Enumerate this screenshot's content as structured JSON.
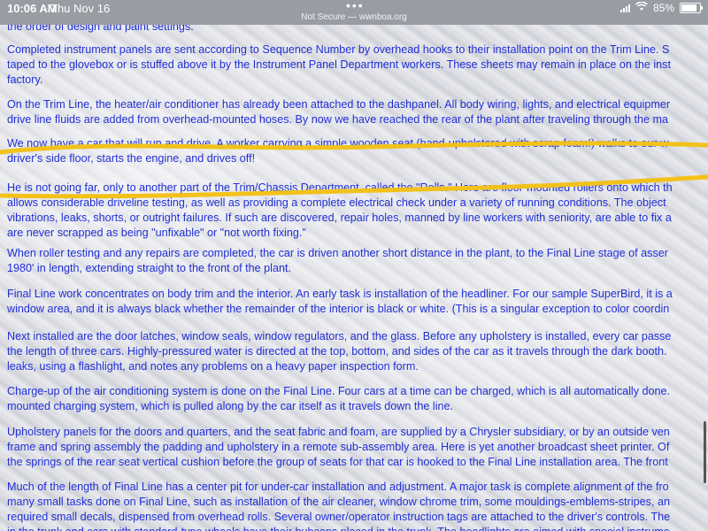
{
  "status_bar": {
    "time": "10:06 AM",
    "date": "Thu Nov 16",
    "url": "Not Secure — wwnboa.org",
    "battery": "85%",
    "battery_level": 0.85
  },
  "paragraphs": [
    {
      "lines": [
        "the order of design and paint settings."
      ]
    },
    {
      "lines": [
        "Completed instrument panels are sent according to Sequence Number by overhead hooks to their installation point on the Trim Line. S",
        "taped to the glovebox or is stuffed above it by the Instrument Panel Department workers. These sheets may remain in place on the inst",
        "factory."
      ]
    },
    {
      "lines": [
        "On the Trim Line, the heater/air conditioner has already been attached to the dashpanel. All body wiring, lights, and electrical equipmer",
        "drive line fluids are added from overhead-mounted hoses. By now we have reached the rear of the plant after traveling through the ma"
      ]
    },
    {
      "lines": [
        "We now have a car that will run and drive. A worker carrying a simple wooden seat (hand-upholstered with scrap foam!) walks to our w",
        "driver's side floor, starts the engine, and drives off!"
      ]
    },
    {
      "lines": [
        "He is not going far, only to another part of the Trim/Chassis Department, called the \"Rolls.\" Here are floor-mounted rollers onto which th",
        "allows considerable driveline testing, as well as providing a complete electrical check under a variety of running conditions. The object",
        "vibrations, leaks, shorts, or outright failures. If such are discovered, repair holes, manned by line workers with seniority, are able to fix a",
        "are never scrapped as being \"unfixable\" or \"not worth fixing.\""
      ]
    },
    {
      "lines": [
        "When roller testing and any repairs are completed, the car is driven another short distance in the plant, to the Final Line stage of asser",
        "1980' in length, extending straight to the front of the plant."
      ]
    },
    {
      "lines": [
        "Final Line work concentrates on body trim and the interior. An early task is installation of the headliner. For our sample SuperBird, it is a",
        "window area, and it is always black whether the remainder of the interior is black or white. (This is a singular exception to color coordin"
      ]
    },
    {
      "lines": [
        "Next installed are the door latches, window seals, window regulators, and the glass. Before any upholstery is installed, every car passe",
        "the length of three cars. Highly-pressured water is directed at the top, bottom, and sides of the car as it travels through the dark booth.",
        "leaks, using a flashlight, and notes any problems on a heavy paper inspection form."
      ]
    },
    {
      "lines": [
        "Charge-up of the air conditioning system is done on the Final Line. Four cars at a time can be charged, which is all automatically done.",
        "mounted charging system, which is pulled along by the car itself as it travels down the line."
      ]
    },
    {
      "lines": [
        "Upholstery panels for the doors and quarters, and the seat fabric and foam, are supplied by a Chrysler subsidiary, or by an outside ven",
        "frame and spring assembly the padding and upholstery in a remote sub-assembly area. Here is yet another broadcast sheet printer. Of",
        "the springs of the rear seat vertical cushion before the group of seats for that car is hooked to the Final Line installation area. The front"
      ]
    },
    {
      "lines": [
        "Much of the length of Final Line has a center pit for under-car installation and adjustment. A major task is complete alignment of the fro",
        "many small tasks done on Final Line, such as installation of the air cleaner, window chrome trim, some mouldings-emblems-stripes, an",
        "required small decals, dispensed from overhead rolls. Several owner/operator instruction tags are attached to the driver's controls. The",
        "in the trunk and cars with standard-type wheels have their hubcaps placed in the trunk. The headlights are aimed with special instrume"
      ]
    }
  ],
  "highlight": {
    "color": "#f2c21b"
  }
}
